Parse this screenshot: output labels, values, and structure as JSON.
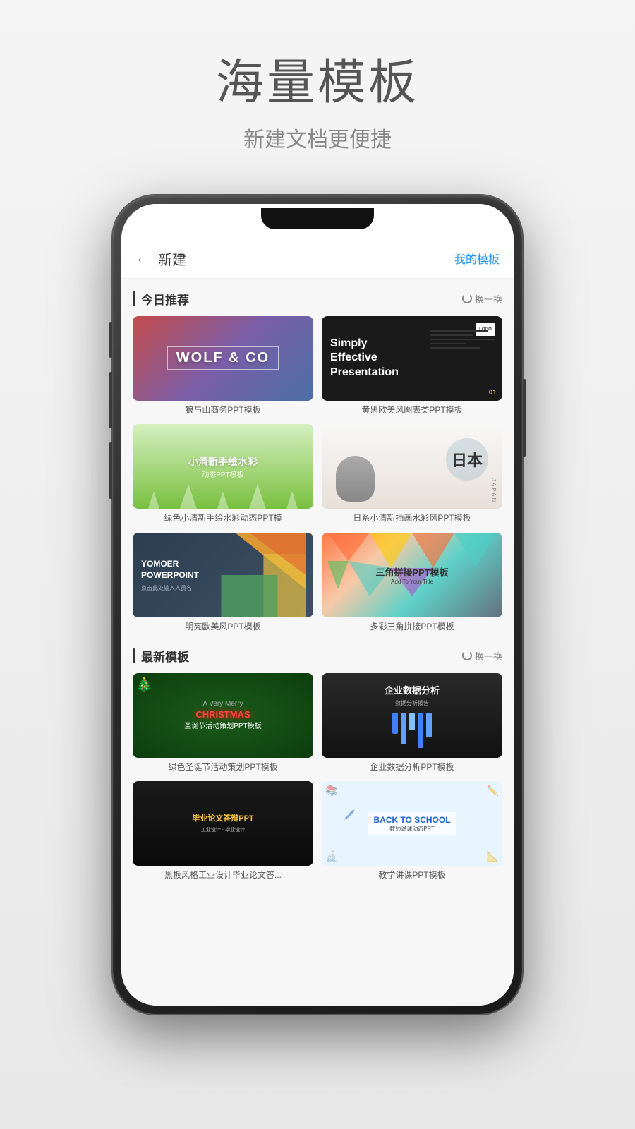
{
  "page": {
    "title_main": "海量模板",
    "title_sub": "新建文档更便捷"
  },
  "app": {
    "header": {
      "back_label": "←",
      "title": "新建",
      "my_template": "我的模板"
    },
    "sections": [
      {
        "id": "today",
        "title": "今日推荐",
        "refresh_label": "换一换",
        "templates": [
          {
            "id": "wolf",
            "title": "WOLF & CO",
            "name": "狼与山商务PPT模板",
            "type": "wolf"
          },
          {
            "id": "simply",
            "title": "Simply Effective Presentation",
            "name": "黄黑欧美风图表类PPT模板",
            "type": "simply"
          },
          {
            "id": "watercolor",
            "title": "小清新手绘水彩",
            "subtitle": "动态PPT模板",
            "name": "绿色小清新手绘水彩动态PPT模",
            "type": "watercolor"
          },
          {
            "id": "japan",
            "title": "日本",
            "name": "日系小清新插画水彩风PPT模板",
            "type": "japan"
          },
          {
            "id": "yomoer",
            "title": "YOMOER POWERPOINT",
            "subtitle": "点击此处输入人员名",
            "name": "明亮欧美风PPT模板",
            "type": "yomoer"
          },
          {
            "id": "triangle",
            "title": "三角拼接PPT模板",
            "subtitle": "Add To Your Title",
            "name": "多彩三角拼接PPT模板",
            "type": "triangle"
          }
        ]
      },
      {
        "id": "latest",
        "title": "最新模板",
        "refresh_label": "换一换",
        "templates": [
          {
            "id": "christmas",
            "title": "A Very Merry CHRISTMAS",
            "subtitle": "圣诞节活动策划PPT模板",
            "name": "绿色圣诞节活动策划PPT模板",
            "type": "christmas"
          },
          {
            "id": "enterprise",
            "title": "企业数据分析",
            "name": "企业数据分析PPT模板",
            "type": "enterprise"
          },
          {
            "id": "graduation",
            "title": "毕业论文答辩PPT",
            "name": "黑板风格工业设计毕业论文答...",
            "type": "graduation"
          },
          {
            "id": "teacher",
            "title": "教师说课动态PPT",
            "name": "教学讲课PPT模板",
            "type": "teacher"
          }
        ]
      }
    ]
  }
}
